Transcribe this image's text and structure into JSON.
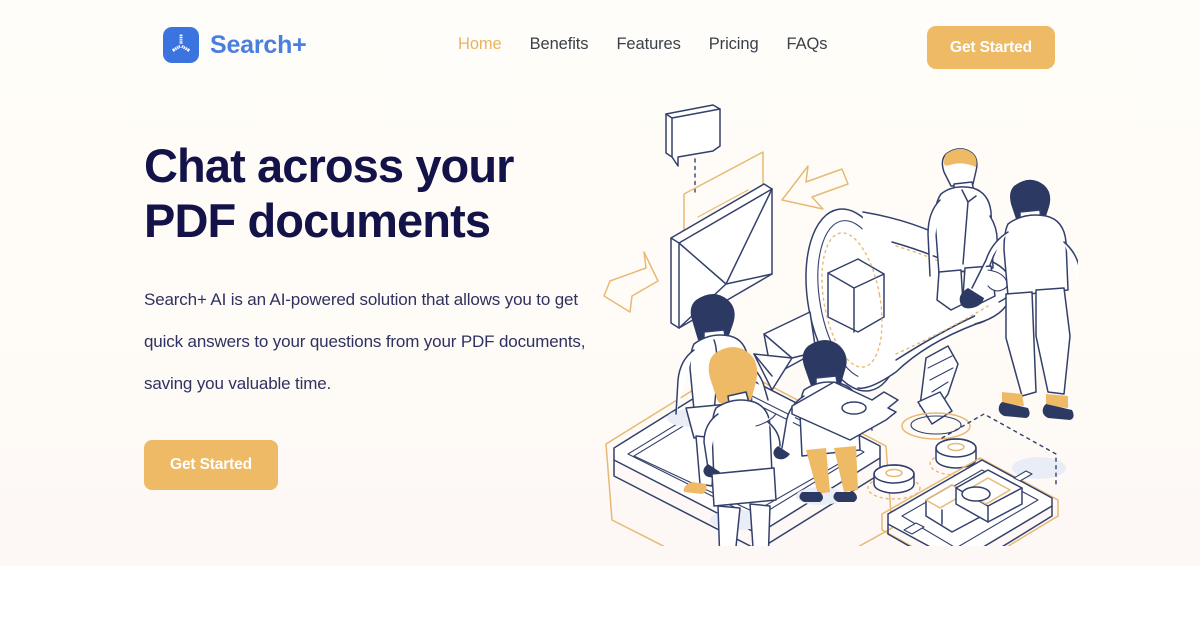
{
  "brand": {
    "name": "Search+",
    "logo_icon": "propeller-tripod-icon",
    "logo_bg_color": "#3b74df",
    "text_color": "#4a7fe0"
  },
  "nav": {
    "items": [
      {
        "label": "Home",
        "active": true
      },
      {
        "label": "Benefits",
        "active": false
      },
      {
        "label": "Features",
        "active": false
      },
      {
        "label": "Pricing",
        "active": false
      },
      {
        "label": "FAQs",
        "active": false
      }
    ],
    "cta_label": "Get Started"
  },
  "hero": {
    "title": "Chat across your PDF documents",
    "subtitle": "Search+ AI is an AI-powered solution that allows you to get quick answers to your questions from your PDF documents, saving you valuable time.",
    "cta_label": "Get Started",
    "illustration": "isometric-megaphone-marketing-illustration"
  },
  "colors": {
    "accent_gold": "#eeba66",
    "nav_active": "#e8b45f",
    "heading_navy": "#131349",
    "body_navy": "#2f3160",
    "brand_blue": "#4a7fe0",
    "hero_background": "#fffdf9",
    "page_background": "#ffffff",
    "line_navy": "#33406b",
    "line_gold": "#e7b974"
  }
}
